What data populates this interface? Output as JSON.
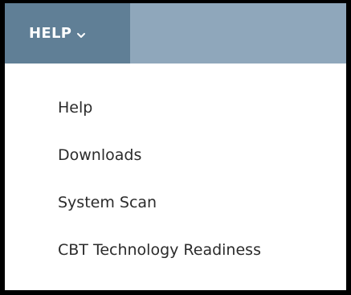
{
  "menubar": {
    "active_menu_label": "HELP",
    "active_menu_icon": "chevron-down-icon",
    "tab_color": "#607f96",
    "bar_color": "#8fa7bb"
  },
  "dropdown": {
    "items": [
      {
        "label": "Help"
      },
      {
        "label": "Downloads"
      },
      {
        "label": "System Scan"
      },
      {
        "label": "CBT Technology Readiness"
      }
    ]
  }
}
